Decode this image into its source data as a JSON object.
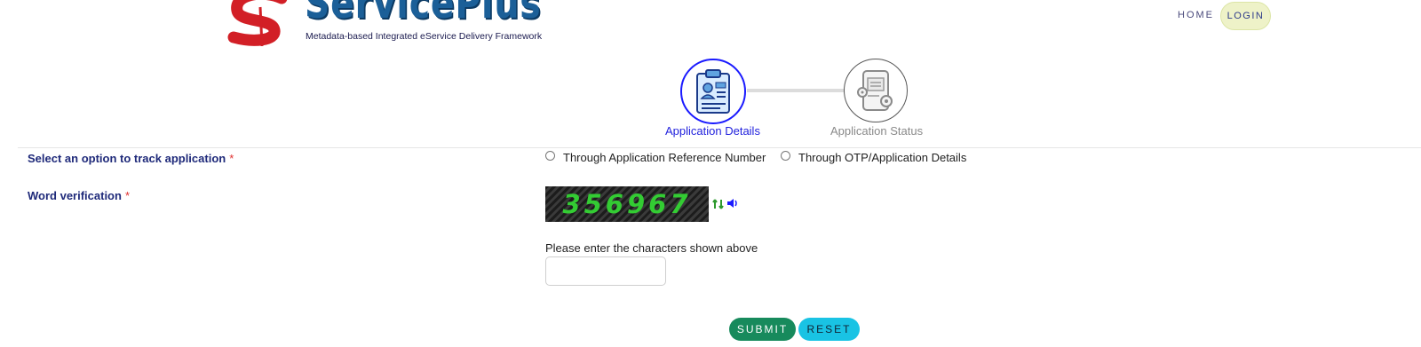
{
  "header": {
    "logo_name": "ServicePlus",
    "logo_tagline": "Metadata-based Integrated eService Delivery Framework",
    "nav": {
      "home": "HOME",
      "login": "LOGIN"
    }
  },
  "stepper": {
    "steps": [
      {
        "label": "Application Details",
        "state": "active",
        "icon": "clipboard-id-icon"
      },
      {
        "label": "Application Status",
        "state": "inactive",
        "icon": "tablet-gears-icon"
      }
    ]
  },
  "form": {
    "track_option": {
      "label": "Select an option to track application",
      "required_mark": "*",
      "options": [
        {
          "label": "Through Application Reference Number",
          "selected": false
        },
        {
          "label": "Through OTP/Application Details",
          "selected": false
        }
      ]
    },
    "word_verification": {
      "label": "Word verification",
      "required_mark": "*",
      "captcha_text": "356967",
      "refresh_icon": "refresh-icon",
      "audio_icon": "speaker-icon",
      "hint": "Please enter the characters shown above",
      "input_value": ""
    },
    "buttons": {
      "submit": "SUBMIT",
      "reset": "RESET"
    }
  },
  "colors": {
    "primary_blue": "#1a1aff",
    "label_navy": "#1f2a7a",
    "required_red": "#e0302f",
    "submit_green": "#178a5c",
    "reset_cyan": "#19c3e4",
    "captcha_green": "#33cc33",
    "login_bg": "#eef2c8"
  }
}
